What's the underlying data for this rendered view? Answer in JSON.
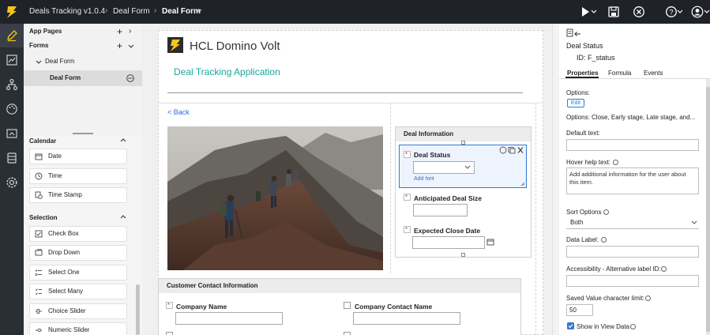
{
  "topbar": {
    "app_title": "Deals Tracking v1.0.4",
    "crumb_form": "Deal Form",
    "crumb_current": "Deal Form",
    "icons": [
      "run-icon",
      "save-icon",
      "close-icon",
      "help-icon",
      "user-icon"
    ]
  },
  "rail": {
    "icons": [
      "edit-icon",
      "chart-icon",
      "tree-icon",
      "palette-icon",
      "data-icon",
      "database-icon",
      "settings-icon"
    ]
  },
  "tree": {
    "app_pages": "App Pages",
    "forms": "Forms",
    "form_group": "Deal Form",
    "form_item": "Deal Form"
  },
  "palette": {
    "calendar_header": "Calendar",
    "calendar_items": [
      "Date",
      "Time",
      "Time Stamp"
    ],
    "selection_header": "Selection",
    "selection_items": [
      "Check Box",
      "Drop Down",
      "Select One",
      "Select Many",
      "Choice Slider",
      "Numeric Slider"
    ]
  },
  "canvas": {
    "app_name": "HCL Domino Volt",
    "app_subtitle": "Deal Tracking Application",
    "back_link": "< Back",
    "deal_section_title": "Deal Information",
    "deal_status_label": "Deal Status",
    "add_hint": "Add hint",
    "deal_size_label": "Anticipated Deal Size",
    "close_date_label": "Expected Close Date",
    "contact_section_title": "Customer Contact Information",
    "company_name_label": "Company Name",
    "company_contact_label": "Company Contact Name"
  },
  "props": {
    "title": "Deal Status",
    "id_text": "ID:  F_status",
    "tabs": [
      "Properties",
      "Formula",
      "Events"
    ],
    "options_label": "Options:",
    "edit_label": "Edit",
    "options_value": "Options: Close, Early stage, Late stage, and...",
    "default_text_label": "Default text:",
    "hover_help_label": "Hover help text:",
    "hover_help_value": "Add additional information for the user about this item.",
    "sort_options_label": "Sort Options",
    "sort_options_value": "Both",
    "data_label_label": "Data Label:",
    "accessibility_label": "Accessibility - Alternative label ID:",
    "saved_limit_label": "Saved Value character limit:",
    "saved_limit_value": "50",
    "show_in_view_label": "Show in View Data"
  },
  "colors": {
    "accent": "#1aa79a",
    "link": "#2f6bd3",
    "topbar": "#1f2228",
    "selection": "#2f79d6"
  }
}
